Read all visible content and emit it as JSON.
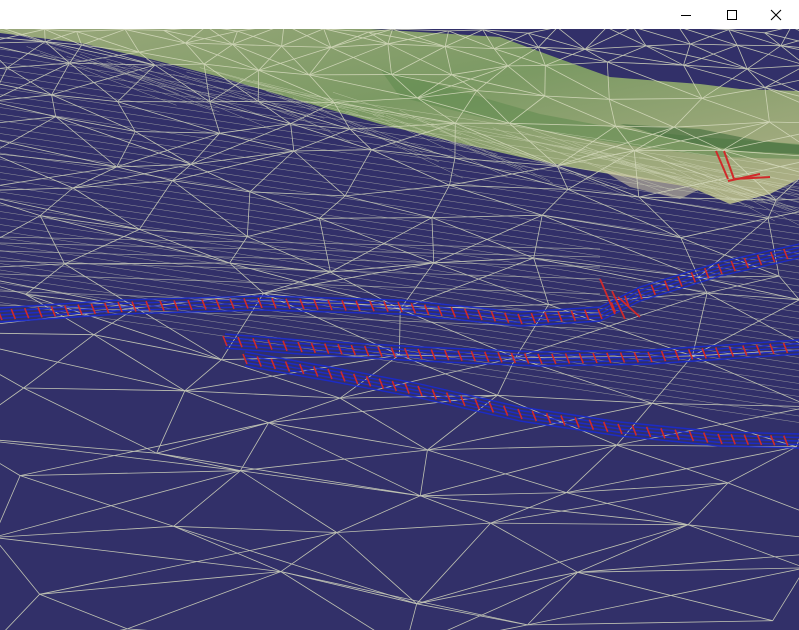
{
  "window": {
    "title": "",
    "controls": [
      {
        "name": "minimize",
        "icon": "minimize-icon"
      },
      {
        "name": "maximize",
        "icon": "maximize-icon"
      },
      {
        "name": "close",
        "icon": "close-icon"
      }
    ]
  },
  "scene": {
    "description_tag": "3d-terrain-wireframe-view",
    "colors": {
      "background": "#323069",
      "wireframe": "#d8dcc0",
      "terrain_texture": "#8aa870",
      "road_lines": "#1a2bd0",
      "road_markers": "#d02a2a"
    },
    "icon": "terrain-mesh-icon"
  }
}
